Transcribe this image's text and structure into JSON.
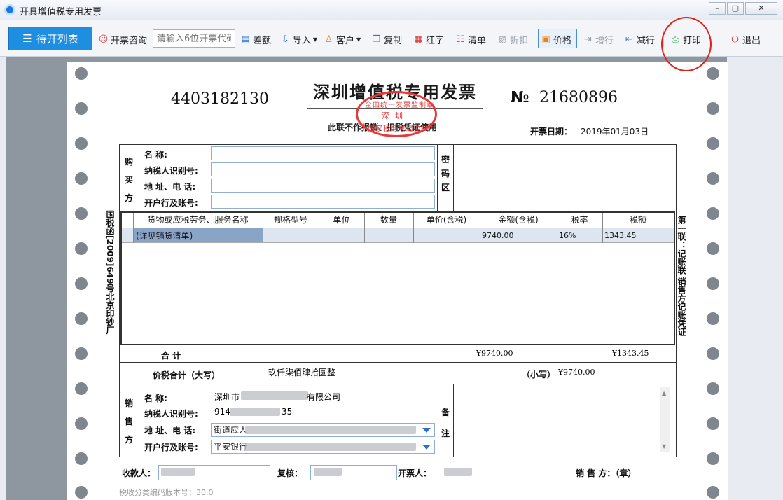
{
  "window": {
    "title": "开具增值税专用发票",
    "minimize": "–",
    "maximize": "▢",
    "close": "✕"
  },
  "toolbar": {
    "pending_label": "待开列表",
    "consult_label": "开票咨询",
    "code_placeholder": "请输入6位开票代码",
    "diff_label": "差额",
    "import_label": "导入",
    "customer_label": "客户",
    "copy_label": "复制",
    "red_label": "红字",
    "clear_label": "清单",
    "discount_label": "折扣",
    "price_label": "价格",
    "addrow_label": "增行",
    "delrow_label": "减行",
    "print_label": "打印",
    "exit_label": "退出"
  },
  "invoice": {
    "title": "深圳增值税专用发票",
    "code": "4403182130",
    "no_symbol": "№",
    "number": "21680896",
    "subtitle": "此联不作报销、扣税凭证使用",
    "date_label": "开票日期：",
    "date": "2019年01月03日",
    "stamp": {
      "top": "全国统一发票监制章",
      "middle": "深圳",
      "bottom": "国家税务总局监制"
    },
    "left_vertical": "国税函[2009]649号北京印钞厂",
    "right_vertical": "第一联：记账联 销售方记账凭证",
    "buyer": {
      "section": "购买方",
      "name_label": "名        称:",
      "tax_id_label": "纳税人识别号:",
      "addr_label": "地 址、电 话:",
      "bank_label": "开户行及账号:"
    },
    "cipher_label": "密码区",
    "table": {
      "headers": [
        "货物或应税劳务、服务名称",
        "规格型号",
        "单位",
        "数量",
        "单价(含税)",
        "金额(含税)",
        "税率",
        "税额"
      ],
      "row": {
        "name": "(详见销货清单)",
        "amount": "9740.00",
        "rate": "16%",
        "tax": "1343.45"
      }
    },
    "total_label": "合          计",
    "total_amount": "¥9740.00",
    "total_tax": "¥1343.45",
    "sum_label": "价税合计（大写）",
    "sum_words": "玖仟柒佰肆拾圆整",
    "sum_small_label": "（小写）",
    "sum_small": "¥9740.00",
    "seller": {
      "section": "销售方",
      "name_label": "名        称:",
      "name_prefix": "深圳市",
      "name_suffix": "有限公司",
      "tax_id_label": "纳税人识别号:",
      "tax_id_prefix": "914",
      "tax_id_suffix": "35",
      "addr_label": "地 址、电 话:",
      "addr_prefix": "街道应人",
      "bank_label": "开户行及账号:",
      "bank_prefix": "平安银行"
    },
    "remark_label": "备注",
    "payee_label": "收款人：",
    "review_label": "复核：",
    "drawer_label": "开票人：",
    "seller_stamp_label": "销 售 方：（章）",
    "version": "税收分类编码版本号：30.0"
  },
  "colors": {
    "primary": "#1e8fe0",
    "stamp": "#e53a3a",
    "selected_cell": "#8aa4c8",
    "row_bg": "#dde6f0"
  }
}
